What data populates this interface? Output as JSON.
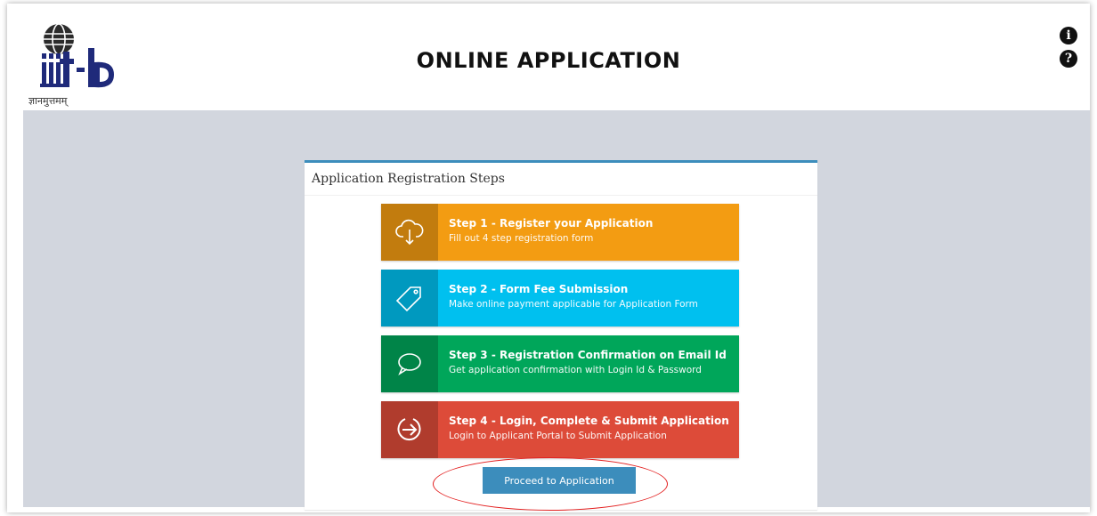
{
  "header": {
    "title": "ONLINE APPLICATION",
    "logo_text": "iiit-b",
    "logo_tagline": "ज्ञानमुत्तमम्",
    "info_icon": "info-circle-icon",
    "help_icon": "question-circle-icon"
  },
  "panel": {
    "title": "Application Registration Steps",
    "steps": [
      {
        "title": "Step 1 - Register your Application",
        "desc": "Fill out 4 step registration form",
        "color": "#f39c12",
        "icon": "cloud-download-icon"
      },
      {
        "title": "Step 2 - Form Fee Submission",
        "desc": "Make online payment applicable for Application Form",
        "color": "#00c0ef",
        "icon": "tag-icon"
      },
      {
        "title": "Step 3 - Registration Confirmation on Email Id",
        "desc": "Get application confirmation with Login Id & Password",
        "color": "#00a65a",
        "icon": "speech-bubble-icon"
      },
      {
        "title": "Step 4 - Login, Complete & Submit Application",
        "desc": "Login to Applicant Portal to Submit Application",
        "color": "#dd4b39",
        "icon": "sign-in-icon"
      }
    ],
    "proceed_label": "Proceed to Application"
  },
  "colors": {
    "background": "#d2d6de",
    "panel_border": "#3c8dbc",
    "button": "#3c8dbc",
    "highlight": "#e32020"
  }
}
